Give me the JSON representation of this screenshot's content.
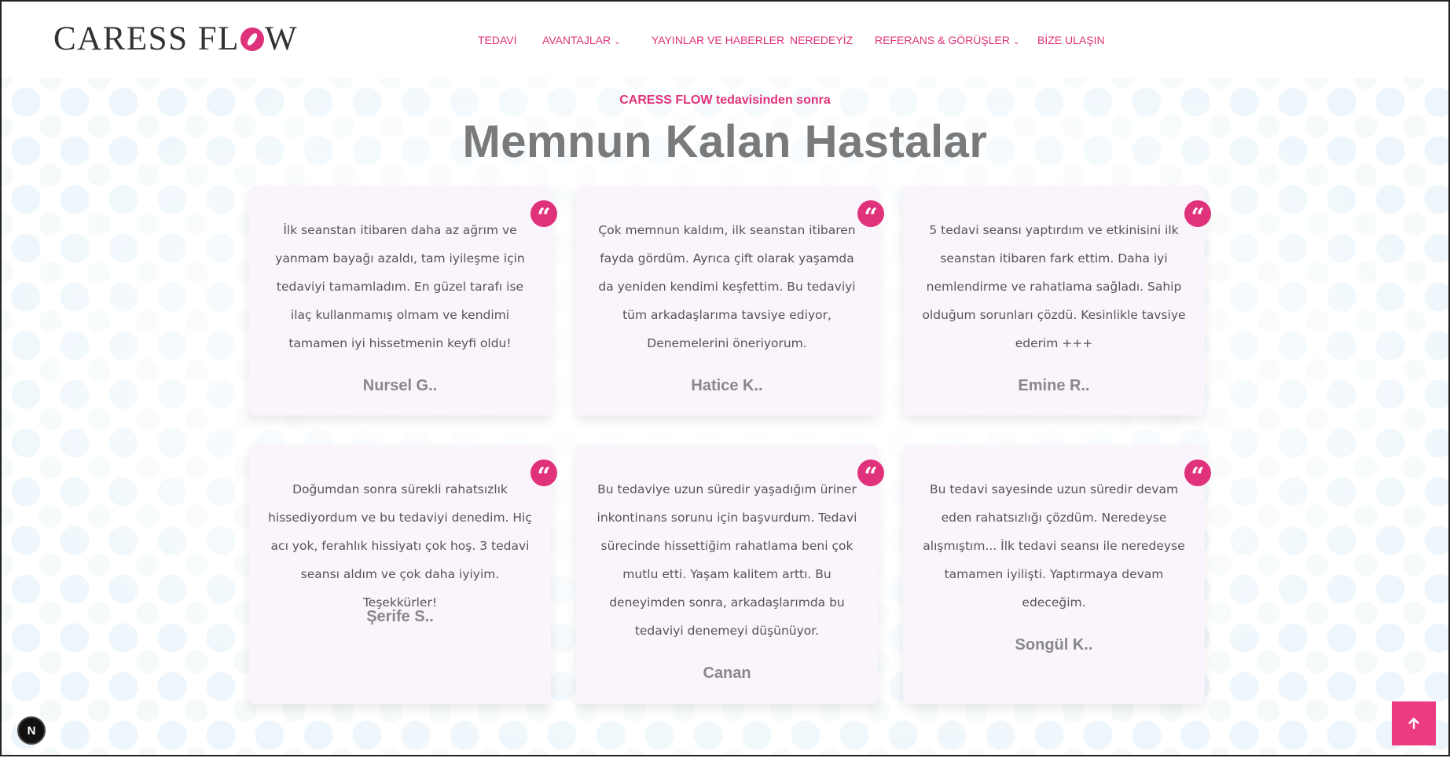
{
  "header": {
    "logo": {
      "part1": "CARESS FL",
      "part2": "W"
    },
    "nav": [
      {
        "label": "TEDAVİ",
        "dropdown": false
      },
      {
        "label": "AVANTAJLAR",
        "dropdown": true
      },
      {
        "label": "YAYINLAR VE HABERLER",
        "dropdown": false
      },
      {
        "label": "NEREDEYİZ",
        "dropdown": false
      },
      {
        "label": "REFERANS & GÖRÜŞLER",
        "dropdown": true
      },
      {
        "label": "BİZE ULAŞIN",
        "dropdown": false
      }
    ]
  },
  "section": {
    "subtitle": "CARESS FLOW tedavisinden sonra",
    "title": "Memnun Kalan Hastalar"
  },
  "testimonials": [
    {
      "text": "İlk seanstan itibaren daha az ağrım ve yanmam bayağı azaldı, tam iyileşme için tedaviyi tamamladım. En güzel tarafı ise ilaç kullanmamış olmam ve kendimi tamamen iyi hissetmenin keyfi oldu!",
      "name": "Nursel G.."
    },
    {
      "text": "Çok memnun kaldım, ilk seanstan itibaren fayda gördüm. Ayrıca çift olarak yaşamda da yeniden kendimi keşfettim. Bu tedaviyi tüm arkadaşlarıma tavsiye ediyor, Denemelerini öneriyorum.",
      "name": "Hatice K.."
    },
    {
      "text": "5 tedavi seansı yaptırdım ve etkinisini ilk seanstan itibaren fark ettim. Daha iyi nemlendirme ve rahatlama sağladı. Sahip olduğum sorunları çözdü. Kesinlikle tavsiye ederim +++",
      "name": "Emine R.."
    },
    {
      "text": "Doğumdan sonra sürekli rahatsızlık hissediyordum ve bu tedaviyi denedim. Hiç acı yok, ferahlık hissiyatı çok hoş. 3 tedavi seansı aldım ve çok daha iyiyim. Teşekkürler!",
      "name": "Şerife S.."
    },
    {
      "text": "Bu tedaviye uzun süredir yaşadığım üriner inkontinans sorunu için başvurdum. Tedavi sürecinde hissettiğim rahatlama beni çok mutlu etti. Yaşam kalitem arttı. Bu deneyimden sonra, arkadaşlarımda bu tedaviyi denemeyi düşünüyor.",
      "name": "Canan"
    },
    {
      "text": "Bu tedavi sayesinde uzun süredir devam eden rahatsızlığı çözdüm. Neredeyse alışmıştım... İlk tedavi seansı ile neredeyse tamamen iyilişti. Yaptırmaya devam edeceğim.",
      "name": "Songül K.."
    }
  ],
  "widgets": {
    "badge": "N",
    "scroll_top_icon": "arrow-up-icon"
  },
  "colors": {
    "accent": "#e0327a",
    "title": "#7a7a7a",
    "card_bg": "#faf4fc"
  }
}
